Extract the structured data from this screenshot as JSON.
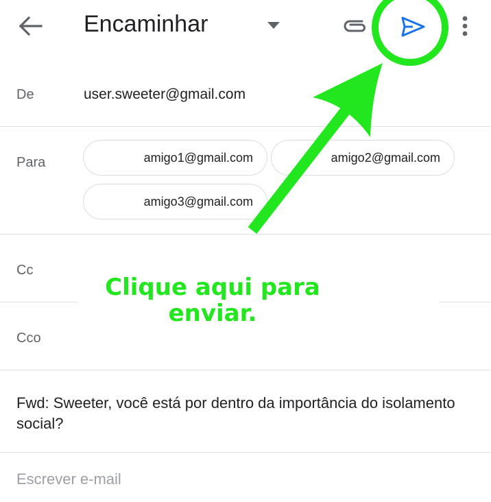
{
  "toolbar": {
    "title": "Encaminhar",
    "icons": [
      "arrow-back-icon",
      "dropdown-caret-icon",
      "paperclip-icon",
      "send-icon",
      "more-vert-icon"
    ]
  },
  "from": {
    "label": "De",
    "value": "user.sweeter@gmail.com"
  },
  "to": {
    "label": "Para",
    "recipients": [
      "amigo1@gmail.com",
      "amigo2@gmail.com",
      "amigo3@gmail.com"
    ]
  },
  "cc": {
    "label": "Cc"
  },
  "bcc": {
    "label": "Cco"
  },
  "subject": "Fwd: Sweeter, você está por dentro da importância do isolamento social?",
  "body": {
    "placeholder": "Escrever e-mail"
  },
  "annotation": {
    "line1": "Clique aqui para",
    "line2": "enviar.",
    "color": "#22e61e"
  },
  "colors": {
    "send_icon": "#1a73e8",
    "icon_gray": "#5f6368",
    "annotation": "#22e61e"
  }
}
